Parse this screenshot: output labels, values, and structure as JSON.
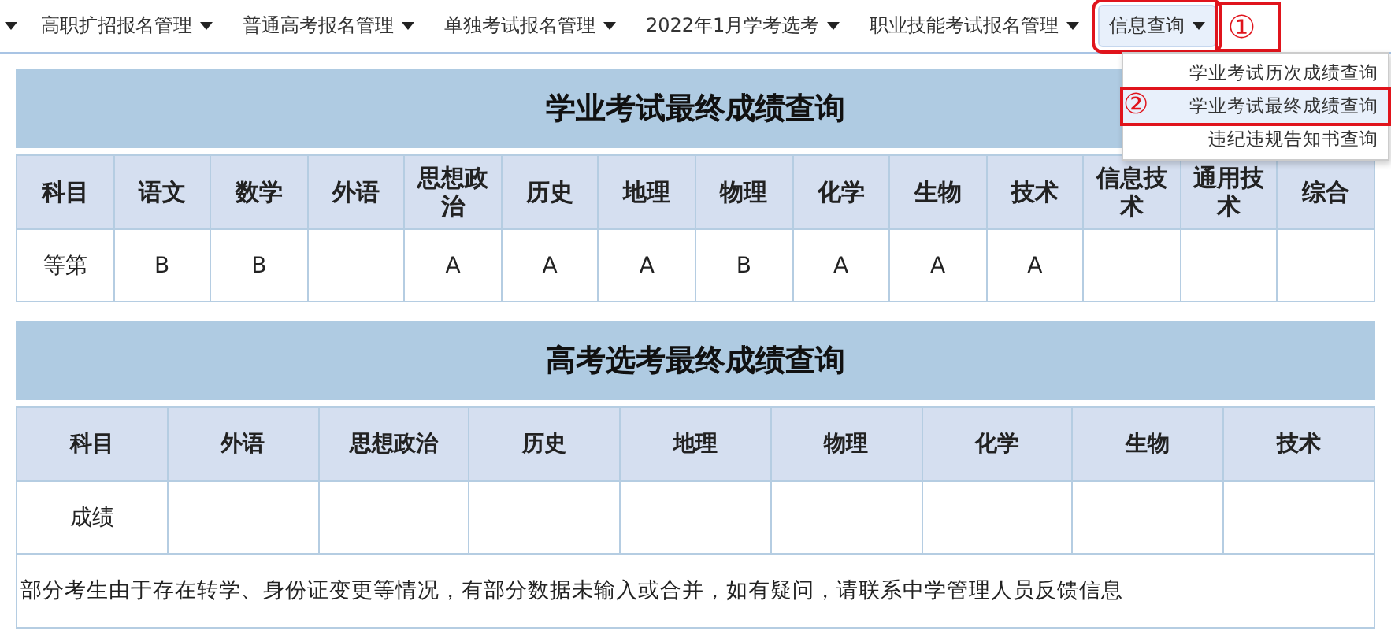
{
  "nav": {
    "items": [
      {
        "label": "高职扩招报名管理",
        "selected": false
      },
      {
        "label": "普通高考报名管理",
        "selected": false
      },
      {
        "label": "单独考试报名管理",
        "selected": false
      },
      {
        "label": "2022年1月学考选考",
        "selected": false
      },
      {
        "label": "职业技能考试报名管理",
        "selected": false
      },
      {
        "label": "信息查询",
        "selected": true
      }
    ],
    "callout": "①"
  },
  "dropdown": {
    "items": [
      {
        "label": "学业考试历次成绩查询",
        "selected": false
      },
      {
        "label": "学业考试最终成绩查询",
        "selected": true
      },
      {
        "label": "违纪违规告知书查询",
        "selected": false
      }
    ],
    "callout": "②"
  },
  "sections": [
    {
      "title": "学业考试最终成绩查询",
      "columns": [
        "科目",
        "语文",
        "数学",
        "外语",
        "思想政治",
        "历史",
        "地理",
        "物理",
        "化学",
        "生物",
        "技术",
        "信息技术",
        "通用技术",
        "综合"
      ],
      "rows": [
        [
          "等第",
          "B",
          "B",
          "",
          "A",
          "A",
          "A",
          "B",
          "A",
          "A",
          "A",
          "",
          "",
          ""
        ]
      ]
    },
    {
      "title": "高考选考最终成绩查询",
      "columns": [
        "科目",
        "外语",
        "思想政治",
        "历史",
        "地理",
        "物理",
        "化学",
        "生物",
        "技术"
      ],
      "rows": [
        [
          "成绩",
          "",
          "",
          "",
          "",
          "",
          "",
          "",
          ""
        ]
      ],
      "note": "部分考生由于存在转学、身份证变更等情况，有部分数据未输入或合并，如有疑问，请联系中学管理人员反馈信息"
    }
  ]
}
